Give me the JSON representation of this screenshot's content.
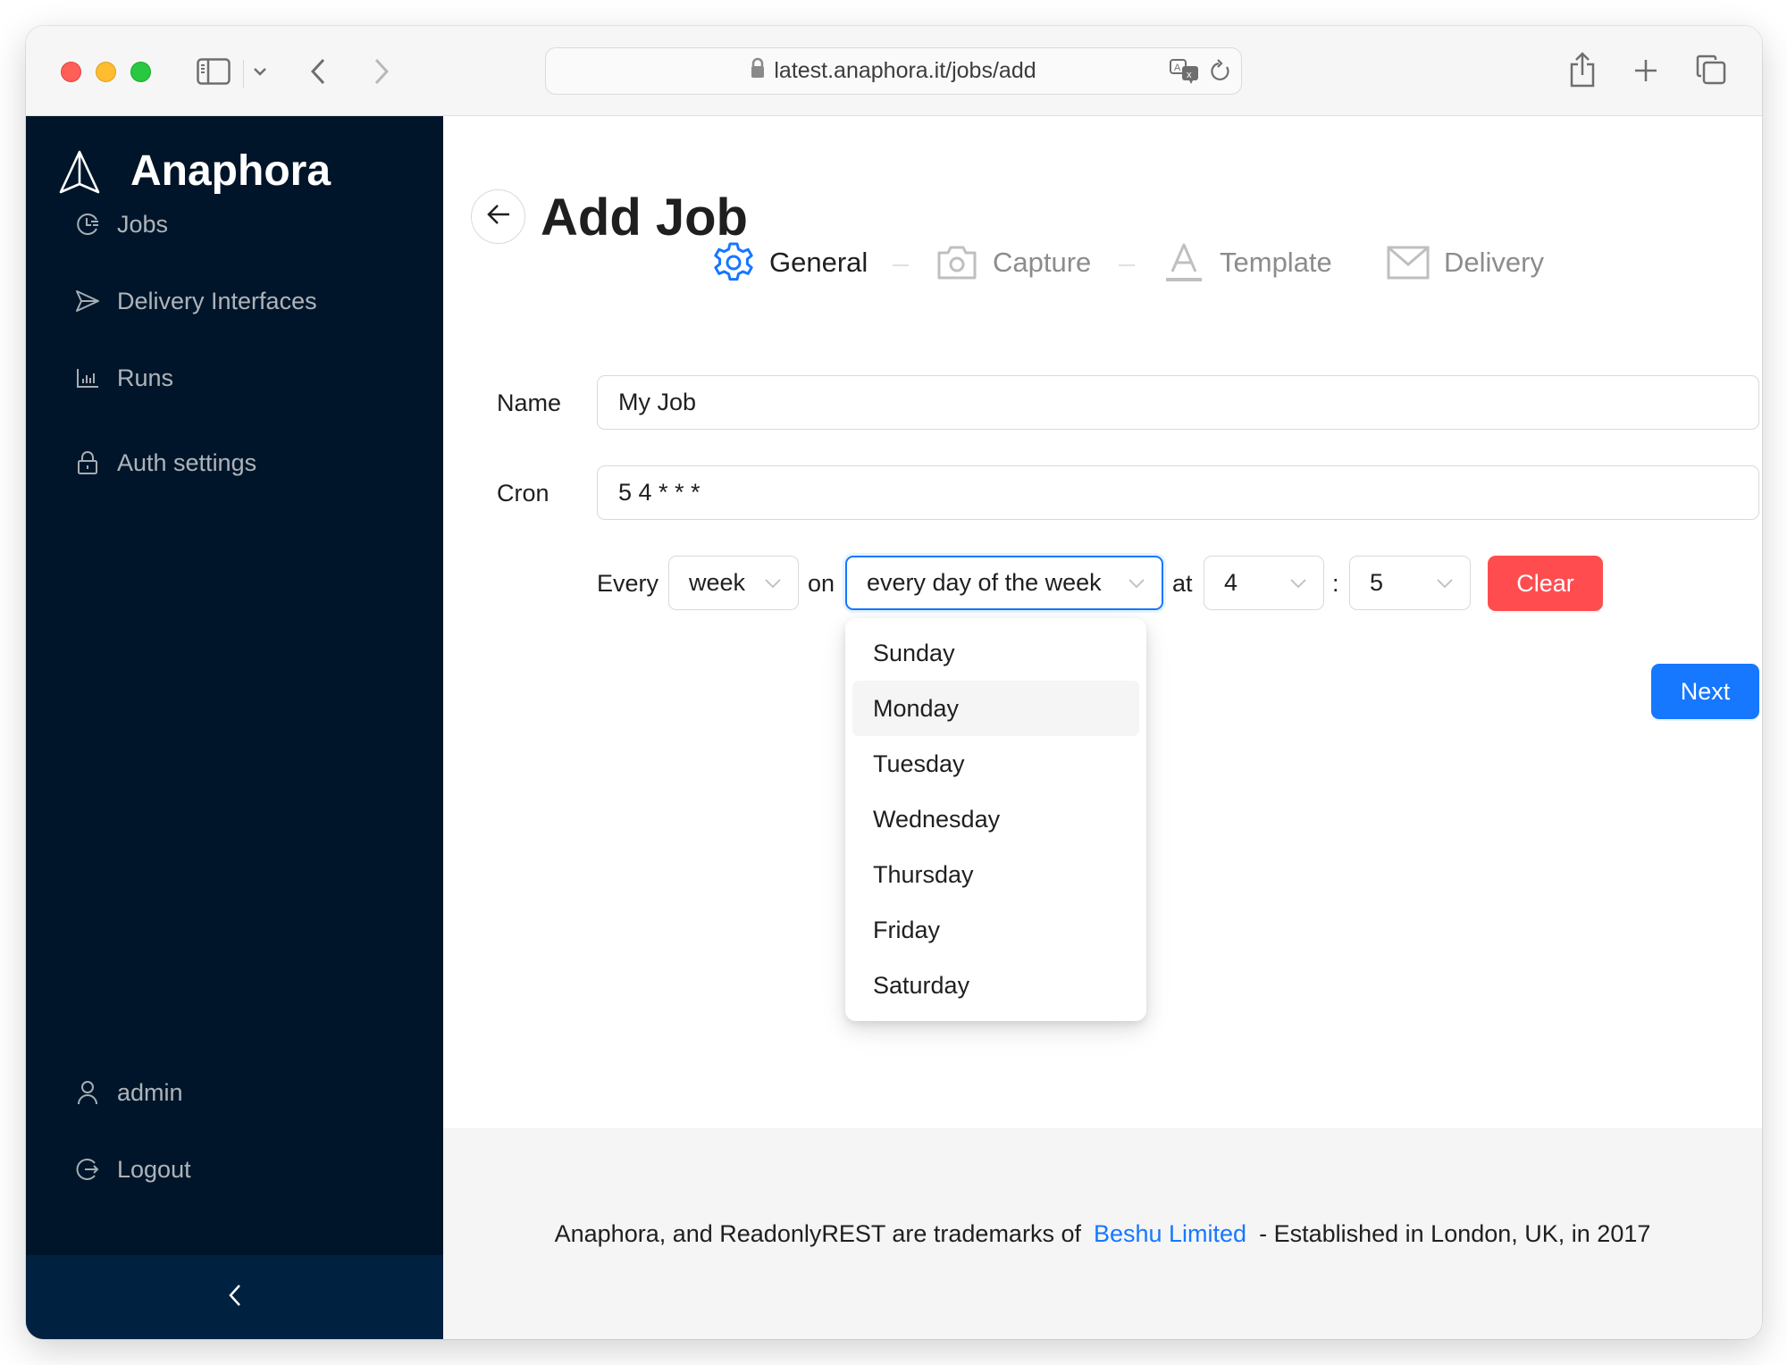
{
  "browser": {
    "url": "latest.anaphora.it/jobs/add",
    "icons": [
      "sidebar-toggle-icon",
      "chevron-down-icon",
      "back-icon",
      "forward-icon",
      "lock-icon",
      "translate-icon",
      "reload-icon",
      "share-icon",
      "new-tab-icon",
      "tabs-overview-icon"
    ]
  },
  "sidebar": {
    "brand": "Anaphora",
    "items": [
      {
        "label": "Jobs",
        "icon": "clock-list-icon"
      },
      {
        "label": "Delivery Interfaces",
        "icon": "send-icon"
      },
      {
        "label": "Runs",
        "icon": "bar-chart-icon"
      },
      {
        "label": "Auth settings",
        "icon": "lock-icon"
      }
    ],
    "bottom_items": [
      {
        "label": "admin",
        "icon": "user-icon"
      },
      {
        "label": "Logout",
        "icon": "logout-icon"
      }
    ],
    "collapse_icon": "chevron-left-icon",
    "colors": {
      "background": "#001529",
      "collapse_bar": "#002140"
    }
  },
  "page": {
    "title": "Add Job",
    "steps": [
      {
        "label": "General",
        "icon": "gear-icon",
        "state": "active"
      },
      {
        "label": "Capture",
        "icon": "camera-icon",
        "state": "pending"
      },
      {
        "label": "Template",
        "icon": "font-icon",
        "state": "pending"
      },
      {
        "label": "Delivery",
        "icon": "mail-icon",
        "state": "pending"
      }
    ],
    "form": {
      "name_label": "Name",
      "name_value": "My Job",
      "cron_label": "Cron",
      "cron_value": "5 4 * * *",
      "schedule": {
        "every_label": "Every",
        "period_value": "week",
        "on_label": "on",
        "day_value": "every day of the week",
        "at_label": "at",
        "hour_value": "4",
        "colon": ":",
        "minute_value": "5",
        "clear_label": "Clear"
      },
      "day_options": [
        "Sunday",
        "Monday",
        "Tuesday",
        "Wednesday",
        "Thursday",
        "Friday",
        "Saturday"
      ],
      "hovered_option": "Monday"
    },
    "next_label": "Next",
    "colors": {
      "primary": "#1677ff",
      "danger": "#ff4d4f"
    }
  },
  "footer": {
    "text_before": "Anaphora, and ReadonlyREST are trademarks of",
    "link_text": "Beshu Limited",
    "text_after": "- Established in London, UK, in 2017"
  }
}
